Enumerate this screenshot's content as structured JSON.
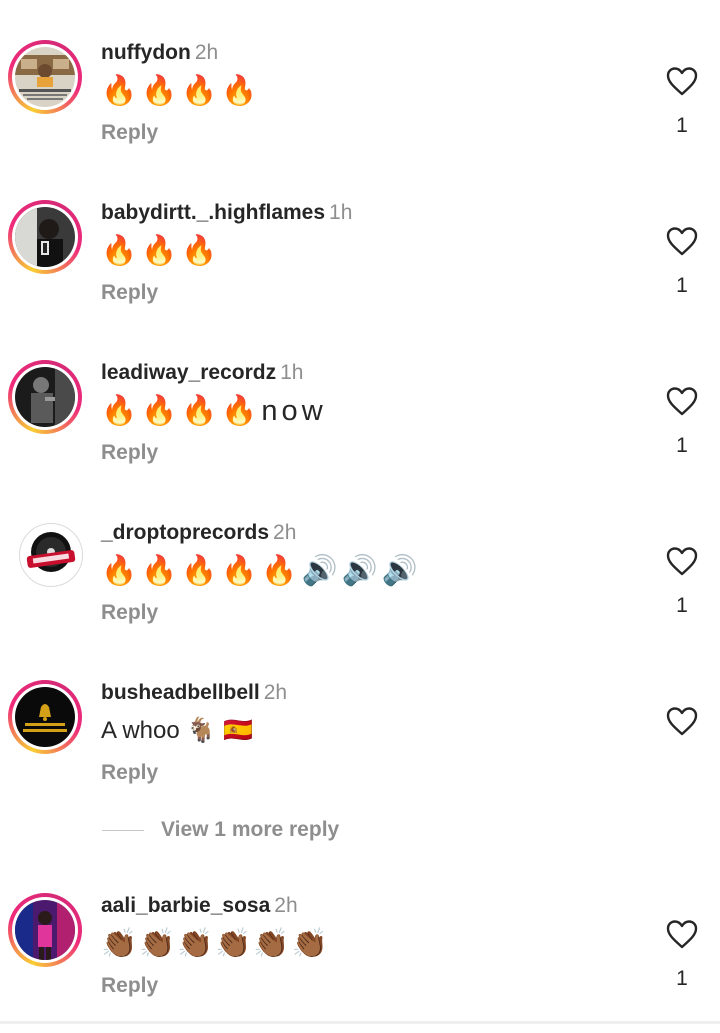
{
  "comments": [
    {
      "username": "nuffydon",
      "time": "2h",
      "text": "🔥🔥🔥🔥",
      "reply_label": "Reply",
      "likes": "1",
      "avatar": "studio-photo"
    },
    {
      "username": "babydirtt._.highflames",
      "time": "1h",
      "text": "🔥🔥🔥",
      "reply_label": "Reply",
      "likes": "1",
      "avatar": "mirror-selfie"
    },
    {
      "username": "leadiway_recordz",
      "time": "1h",
      "text": "🔥🔥🔥🔥now",
      "reply_label": "Reply",
      "likes": "1",
      "avatar": "dark-portrait"
    },
    {
      "username": "_droptoprecords",
      "time": "2h",
      "text": "🔥🔥🔥🔥🔥🔊🔊🔊",
      "reply_label": "Reply",
      "likes": "1",
      "avatar": "droptop-logo"
    },
    {
      "username": "busheadbellbell",
      "time": "2h",
      "text": "A whoo 🐐 🇪🇸",
      "reply_label": "Reply",
      "likes": "",
      "avatar": "bell-entertainment-logo"
    },
    {
      "username": "aali_barbie_sosa",
      "time": "2h",
      "text": "👏🏾👏🏾👏🏾👏🏾👏🏾👏🏾",
      "reply_label": "Reply",
      "likes": "1",
      "avatar": "neon-photo"
    }
  ],
  "view_more_replies": "View 1 more reply",
  "icons": {
    "like": "heart-outline-icon"
  },
  "colors": {
    "text": "#262626",
    "secondary": "#8e8e8e",
    "story_ring_start": "#f9ce34",
    "story_ring_end": "#ee2a7b"
  }
}
